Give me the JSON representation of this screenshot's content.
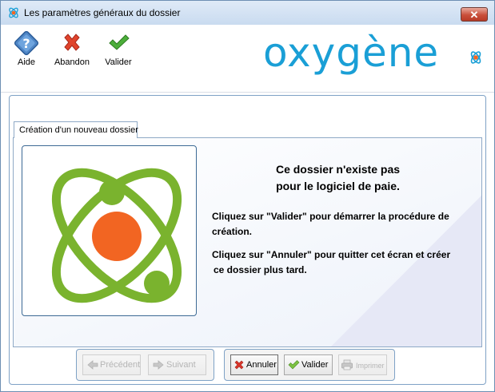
{
  "window": {
    "title": "Les paramètres généraux du dossier",
    "close_label": "✕"
  },
  "toolbar": [
    {
      "label": "Aide",
      "icon": "help-diamond-icon"
    },
    {
      "label": "Abandon",
      "icon": "red-x-icon"
    },
    {
      "label": "Valider",
      "icon": "green-check-icon"
    }
  ],
  "logo": {
    "text": "oxygène"
  },
  "tab": {
    "label": "Création d'un nouveau dossier"
  },
  "message": {
    "title_line1": "Ce dossier n'existe pas",
    "title_line2": "pour le logiciel de paie.",
    "valider_line1": "Cliquez sur \"Valider\" pour démarrer la procédure de",
    "valider_line2": "création.",
    "annuler_line1": "Cliquez sur \"Annuler\" pour quitter cet écran et créer",
    "annuler_line2": "ce dossier plus tard."
  },
  "nav_buttons": {
    "previous": "Précédent",
    "next": "Suivant"
  },
  "action_buttons": {
    "cancel": "Annuler",
    "validate": "Valider",
    "print": "Imprimer"
  },
  "colors": {
    "accent_blue": "#1a9fd6",
    "atom_green": "#7ab32e",
    "atom_orange": "#f26522",
    "cancel_red": "#d9342b"
  }
}
